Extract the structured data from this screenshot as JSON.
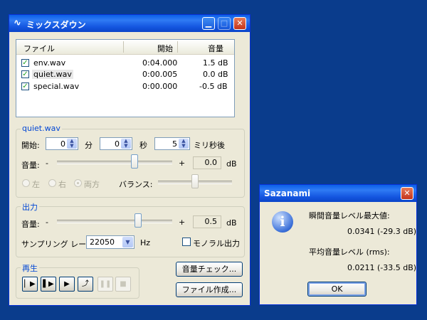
{
  "main_window": {
    "title": "ミックスダウン",
    "list": {
      "columns": [
        "ファイル",
        "開始",
        "音量"
      ],
      "rows": [
        {
          "name": "env.wav",
          "start": "0:04.000",
          "volume": "1.5 dB",
          "checked": true
        },
        {
          "name": "quiet.wav",
          "start": "0:00.005",
          "volume": "0.0 dB",
          "checked": true
        },
        {
          "name": "special.wav",
          "start": "0:00.000",
          "volume": "-0.5 dB",
          "checked": true
        }
      ]
    },
    "track_group": {
      "title": "quiet.wav",
      "start_label": "開始:",
      "min_value": "0",
      "min_unit": "分",
      "sec_value": "0",
      "sec_unit": "秒",
      "ms_value": "5",
      "ms_unit": "ミリ秒後",
      "volume_label": "音量:",
      "minus": "-",
      "plus": "+",
      "volume_value": "0.0",
      "db": "dB",
      "left_label": "左",
      "right_label": "右",
      "both_label": "両方",
      "balance_label": "バランス:"
    },
    "output_group": {
      "title": "出力",
      "volume_label": "音量:",
      "minus": "-",
      "plus": "+",
      "volume_value": "0.5",
      "db": "dB",
      "rate_label": "サンプリング レート:",
      "rate_value": "22050",
      "hz": "Hz",
      "mono_label": "モノラル出力"
    },
    "playback_group": {
      "title": "再生"
    },
    "level_check_button": "音量チェック...",
    "make_file_button": "ファイル作成..."
  },
  "dialog": {
    "title": "Sazanami",
    "peak_label": "瞬間音量レベル最大値:",
    "peak_value": "0.0341 (-29.3 dB)",
    "avg_label": "平均音量レベル (rms):",
    "avg_value": "0.0211 (-33.5 dB)",
    "ok_label": "OK"
  },
  "colors": {
    "desktop": "#0a3c8c",
    "titlebar": "#1456e0",
    "window_bg": "#ece9d8",
    "group_label": "#0046d5"
  }
}
